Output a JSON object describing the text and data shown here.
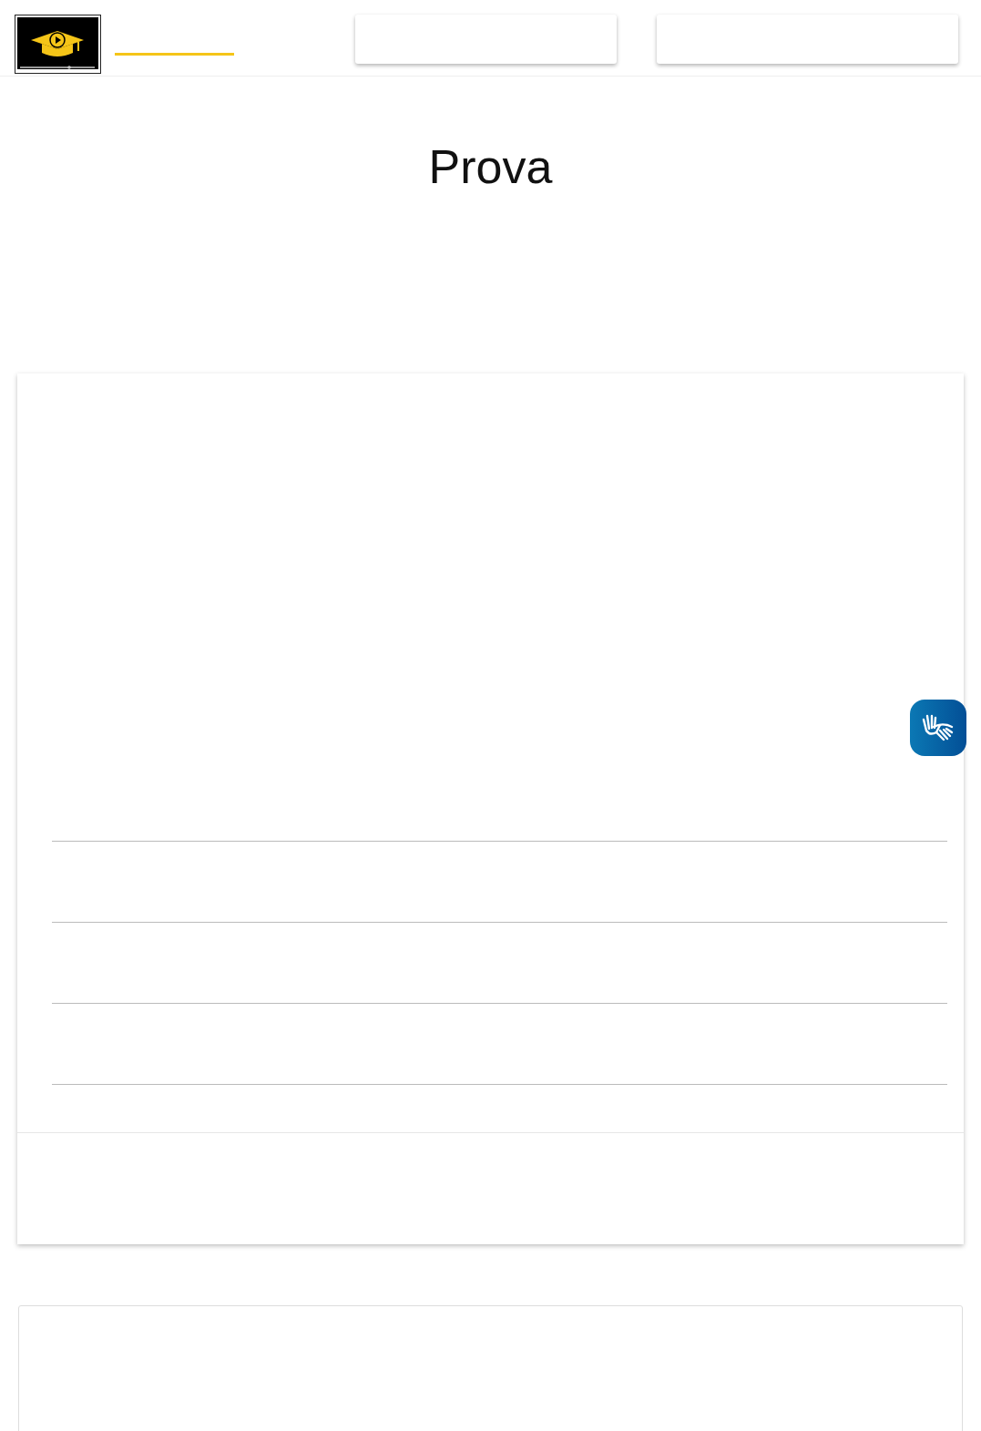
{
  "page": {
    "title": "Prova"
  }
}
